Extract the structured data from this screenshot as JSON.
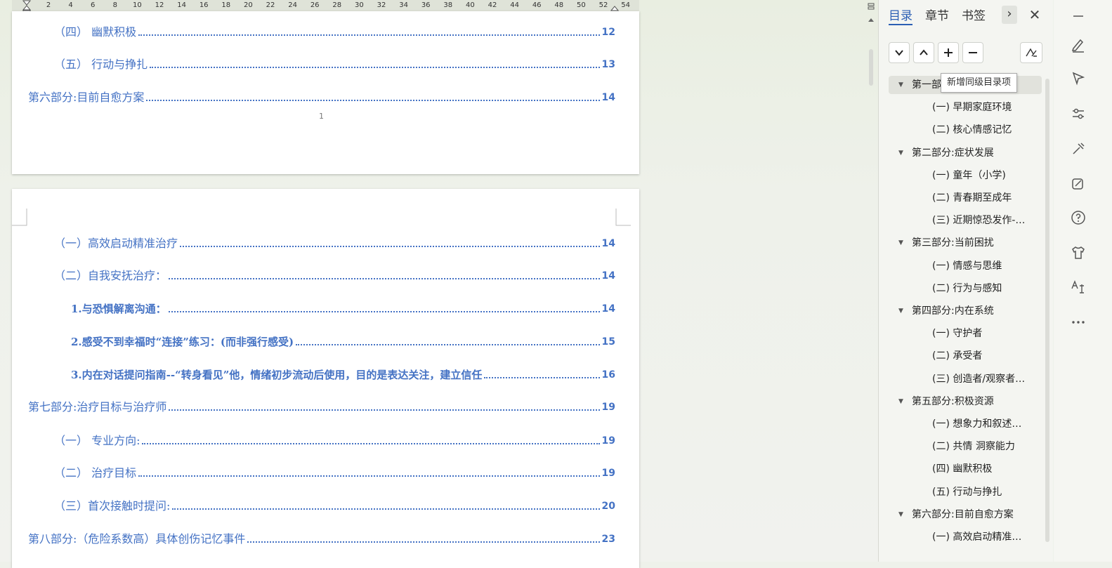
{
  "ruler": {
    "ticks": [
      "2",
      "4",
      "6",
      "8",
      "10",
      "12",
      "14",
      "16",
      "18",
      "20",
      "22",
      "24",
      "26",
      "28",
      "30",
      "32",
      "34",
      "36",
      "38",
      "40",
      "42",
      "44",
      "46",
      "48",
      "50",
      "52",
      "54"
    ]
  },
  "page1": {
    "lines": [
      {
        "text": "（四）  幽默积极",
        "page": "12"
      },
      {
        "text": "（五）  行动与挣扎",
        "page": "13"
      },
      {
        "text": "第六部分:目前自愈方案",
        "page": "14"
      }
    ],
    "page_number": "1"
  },
  "page2": {
    "lines": [
      {
        "text": "（一）高效启动精准治疗",
        "page": "14"
      },
      {
        "text": "（二）自我安抚治疗：",
        "page": "14"
      },
      {
        "text": "1.与恐惧解离沟通：",
        "page": "14"
      },
      {
        "text": "2.感受不到幸福时“连接”练习：(而非强行感受)",
        "page": "15"
      },
      {
        "text": "3.内在对话提问指南--“转身看见”他，情绪初步流动后使用，目的是表达关注，建立信任",
        "page": "16"
      },
      {
        "text": "第七部分:治疗目标与治疗师",
        "page": "19"
      },
      {
        "text": "（一）  专业方向:",
        "page": "19"
      },
      {
        "text": "（二）  治疗目标",
        "page": "19"
      },
      {
        "text": "（三）首次接触时提问:",
        "page": "20"
      },
      {
        "text": "第八部分:（危险系数高）具体创伤记忆事件",
        "page": "23"
      }
    ]
  },
  "nav": {
    "tabs": [
      "目录",
      "章节",
      "书签"
    ],
    "tooltip": "新增同级目录项",
    "items": [
      {
        "label": "第一部分",
        "level": 1
      },
      {
        "label": "(一)  早期家庭环境",
        "level": 2
      },
      {
        "label": "(二)  核心情感记忆",
        "level": 2
      },
      {
        "label": "第二部分:症状发展",
        "level": 1
      },
      {
        "label": "(一)  童年（小学)",
        "level": 2
      },
      {
        "label": "(二)  青春期至成年",
        "level": 2
      },
      {
        "label": "(三)  近期惊恐发作-…",
        "level": 2
      },
      {
        "label": "第三部分:当前困扰",
        "level": 1
      },
      {
        "label": "(一)  情感与思维",
        "level": 2
      },
      {
        "label": "(二)  行为与感知",
        "level": 2
      },
      {
        "label": "第四部分:内在系统",
        "level": 1
      },
      {
        "label": "(一)  守护者",
        "level": 2
      },
      {
        "label": "(二)  承受者",
        "level": 2
      },
      {
        "label": "(三)  创造者/观察者…",
        "level": 2
      },
      {
        "label": "第五部分:积极资源",
        "level": 1
      },
      {
        "label": "(一)  想象力和叙述…",
        "level": 2
      },
      {
        "label": "(二)  共情 洞察能力",
        "level": 2
      },
      {
        "label": "(四)  幽默积极",
        "level": 2
      },
      {
        "label": "(五)  行动与挣扎",
        "level": 2
      },
      {
        "label": "第六部分:目前自愈方案",
        "level": 1
      },
      {
        "label": "(一)  高效启动精准…",
        "level": 2
      }
    ]
  },
  "icons": {
    "rail": [
      "minimize-icon",
      "pen-icon",
      "select-cursor-icon",
      "sliders-icon",
      "tools-icon",
      "ai-writing-icon",
      "help-icon",
      "tshirt-icon",
      "translate-icon",
      "more-icon"
    ]
  },
  "colors": {
    "toc_blue": "#4472c4",
    "tab_active": "#2b5fb4"
  }
}
